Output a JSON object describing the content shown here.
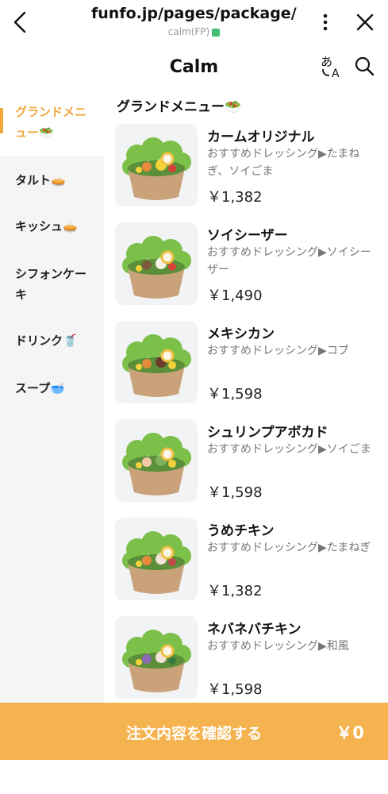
{
  "browser": {
    "url": "funfo.jp/pages/package/...",
    "subtitle": "calm(FP)"
  },
  "app": {
    "title": "Calm"
  },
  "sidebar": {
    "items": [
      {
        "label": "グランドメニュー🥗",
        "active": true
      },
      {
        "label": "タルト🥧"
      },
      {
        "label": "キッシュ🥧"
      },
      {
        "label": "シフォンケーキ"
      },
      {
        "label": "ドリンク🥤"
      },
      {
        "label": "スープ🥣"
      }
    ]
  },
  "section": {
    "title": "グランドメニュー🥗"
  },
  "menu": [
    {
      "name": "カームオリジナル",
      "desc": "おすすめドレッシング▶たまねぎ、ソイごま",
      "price": "￥1,382"
    },
    {
      "name": "ソイシーザー",
      "desc": "おすすめドレッシング▶ソイシーザー",
      "price": "￥1,490"
    },
    {
      "name": "メキシカン",
      "desc": "おすすめドレッシング▶コブ",
      "price": "￥1,598"
    },
    {
      "name": "シュリンプアボカド",
      "desc": "おすすめドレッシング▶ソイごま",
      "price": "￥1,598"
    },
    {
      "name": "うめチキン",
      "desc": "おすすめドレッシング▶たまねぎ",
      "price": "￥1,382"
    },
    {
      "name": "ネバネバチキン",
      "desc": "おすすめドレッシング▶和風",
      "price": "￥1,598"
    }
  ],
  "order": {
    "label": "注文内容を確認する",
    "total": "￥0"
  },
  "colors": {
    "accent": "#f0a83c",
    "order_bar": "#f5b350"
  },
  "icons": [
    "back-arrow-icon",
    "more-vertical-icon",
    "close-icon",
    "translate-icon",
    "search-icon",
    "salad-bowl-icon"
  ]
}
